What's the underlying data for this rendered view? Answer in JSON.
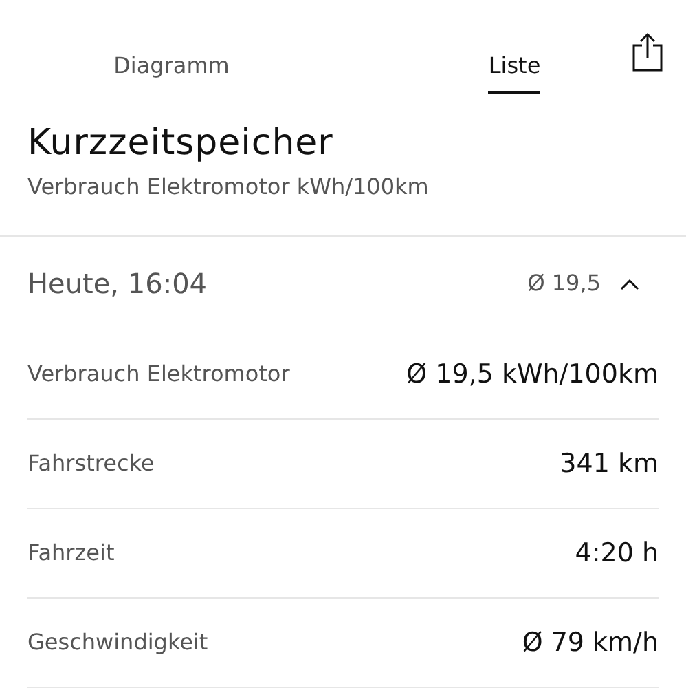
{
  "tabs": [
    {
      "label": "Diagramm",
      "selected": false
    },
    {
      "label": "Liste",
      "selected": true
    }
  ],
  "title": "Kurzzeitspeicher",
  "subtitle": "Verbrauch Elektromotor kWh/100km",
  "section": {
    "date": "Heute, 16:04",
    "average": "Ø 19,5",
    "expanded": true,
    "rows": [
      {
        "label": "Verbrauch Elektromotor",
        "value": "Ø 19,5 kWh/100km"
      },
      {
        "label": "Fahrstrecke",
        "value": "341 km"
      },
      {
        "label": "Fahrzeit",
        "value": "4:20 h"
      },
      {
        "label": "Geschwindigkeit",
        "value": "Ø 79 km/h"
      }
    ]
  }
}
